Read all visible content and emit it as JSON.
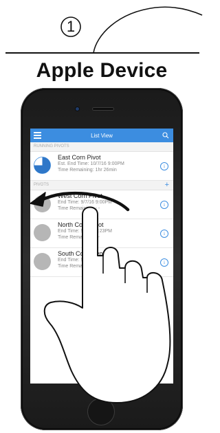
{
  "step": {
    "number": "1"
  },
  "page_title": "Apple Device",
  "app": {
    "title": "List View",
    "running_section": "RUNNING PIVOTS",
    "pivots_section": "PIVOTS",
    "add_label": "+",
    "info_label": "i",
    "running": [
      {
        "name": "East Corn Pivot",
        "line1": "Est. End Time: 10/7/16  9:00PM",
        "line2": "Time Remaining: 1hr 26min",
        "progress": 0.75
      }
    ],
    "pivots": [
      {
        "name": "West Corn Pivot",
        "line1": "End Time: 9/7/16  9:00PM",
        "line2": "Time Remaining: - -"
      },
      {
        "name": "North Corn Pivot",
        "line1": "End Time: 9/7/16  3:23PM",
        "line2": "Time Remaining: - -"
      },
      {
        "name": "South Corn Pivot",
        "line1": "End Time: 9/7/16  9:00PM",
        "line2": "Time Remaining: - -"
      }
    ]
  },
  "colors": {
    "accent": "#3c8de0",
    "avatar": "#b6b6b6"
  },
  "icons": {
    "menu": "hamburger-menu-icon",
    "search": "search-icon",
    "info": "info-icon",
    "gesture": "swipe-left-hand-icon"
  }
}
